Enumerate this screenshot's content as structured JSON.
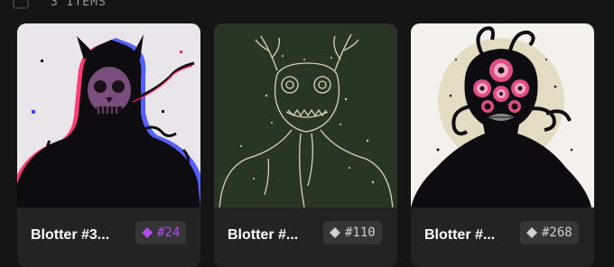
{
  "toolbar": {
    "item_count": "3 ITEMS"
  },
  "cards": [
    {
      "name": "Blotter #3...",
      "rank": "#24",
      "rank_color": "#b44cf0",
      "gem_icon": "diamond-icon"
    },
    {
      "name": "Blotter #...",
      "rank": "#110",
      "rank_color": "#d0d0d0",
      "gem_icon": "diamond-icon"
    },
    {
      "name": "Blotter #...",
      "rank": "#268",
      "rank_color": "#d0d0d0",
      "gem_icon": "diamond-icon"
    }
  ]
}
